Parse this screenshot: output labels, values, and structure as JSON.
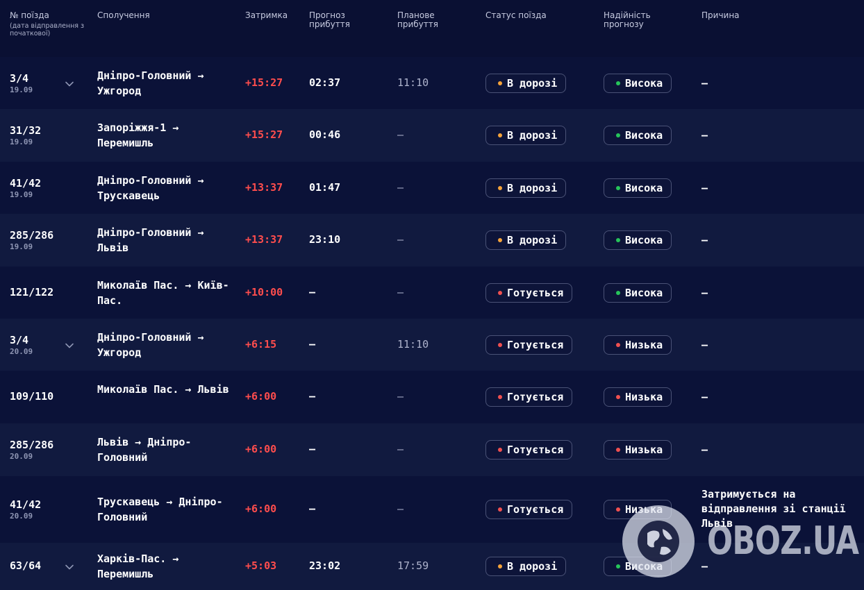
{
  "header": {
    "train_no": "№ поїзда",
    "train_no_sub": "(дата відправлення з початкової)",
    "route": "Сполучення",
    "delay": "Затримка",
    "forecast": "Прогноз прибуття",
    "planned": "Планове прибуття",
    "status": "Статус поїзда",
    "reliability": "Надійність прогнозу",
    "reason": "Причина"
  },
  "colors": {
    "delay": "#ff4d4d",
    "status_en_route_dot": "#f5a33a",
    "status_preparing_dot": "#f05050",
    "reliability_high_dot": "#26c45a",
    "reliability_low_dot": "#f05050"
  },
  "rows": [
    {
      "number": "3/4",
      "date": "19.09",
      "expandable": true,
      "from": "Дніпро-Головний",
      "to": "Ужгород",
      "delay": "+15:27",
      "forecast": "02:37",
      "planned": "11:10",
      "status": "В дорозі",
      "status_color": "#f5a33a",
      "reliability": "Висока",
      "reliability_color": "#26c45a",
      "reason": "—"
    },
    {
      "number": "31/32",
      "date": "19.09",
      "expandable": false,
      "from": "Запоріжжя-1",
      "to": "Перемишль",
      "delay": "+15:27",
      "forecast": "00:46",
      "planned": "—",
      "status": "В дорозі",
      "status_color": "#f5a33a",
      "reliability": "Висока",
      "reliability_color": "#26c45a",
      "reason": "—"
    },
    {
      "number": "41/42",
      "date": "19.09",
      "expandable": false,
      "from": "Дніпро-Головний",
      "to": "Трускавець",
      "delay": "+13:37",
      "forecast": "01:47",
      "planned": "—",
      "status": "В дорозі",
      "status_color": "#f5a33a",
      "reliability": "Висока",
      "reliability_color": "#26c45a",
      "reason": "—"
    },
    {
      "number": "285/286",
      "date": "19.09",
      "expandable": false,
      "from": "Дніпро-Головний",
      "to": "Львів",
      "delay": "+13:37",
      "forecast": "23:10",
      "planned": "—",
      "status": "В дорозі",
      "status_color": "#f5a33a",
      "reliability": "Висока",
      "reliability_color": "#26c45a",
      "reason": "—"
    },
    {
      "number": "121/122",
      "date": "",
      "expandable": false,
      "from": "Миколаїв Пас.",
      "to": "Київ-Пас.",
      "delay": "+10:00",
      "forecast": "—",
      "planned": "—",
      "status": "Готується",
      "status_color": "#f05050",
      "reliability": "Висока",
      "reliability_color": "#26c45a",
      "reason": "—"
    },
    {
      "number": "3/4",
      "date": "20.09",
      "expandable": true,
      "from": "Дніпро-Головний",
      "to": "Ужгород",
      "delay": "+6:15",
      "forecast": "—",
      "planned": "11:10",
      "status": "Готується",
      "status_color": "#f05050",
      "reliability": "Низька",
      "reliability_color": "#f05050",
      "reason": "—"
    },
    {
      "number": "109/110",
      "date": "",
      "expandable": false,
      "from": "Миколаїв Пас.",
      "to": "Львів",
      "delay": "+6:00",
      "forecast": "—",
      "planned": "—",
      "status": "Готується",
      "status_color": "#f05050",
      "reliability": "Низька",
      "reliability_color": "#f05050",
      "reason": "—"
    },
    {
      "number": "285/286",
      "date": "20.09",
      "expandable": false,
      "from": "Львів",
      "to": "Дніпро-Головний",
      "delay": "+6:00",
      "forecast": "—",
      "planned": "—",
      "status": "Готується",
      "status_color": "#f05050",
      "reliability": "Низька",
      "reliability_color": "#f05050",
      "reason": "—"
    },
    {
      "number": "41/42",
      "date": "20.09",
      "expandable": false,
      "from": "Трускавець",
      "to": "Дніпро-Головний",
      "delay": "+6:00",
      "forecast": "—",
      "planned": "—",
      "status": "Готується",
      "status_color": "#f05050",
      "reliability": "Низька",
      "reliability_color": "#f05050",
      "reason": "Затримується на відправлення зі станції Львів"
    },
    {
      "number": "63/64",
      "date": "",
      "expandable": true,
      "from": "Харків-Пас.",
      "to": "Перемишль",
      "delay": "+5:03",
      "forecast": "23:02",
      "planned": "17:59",
      "status": "В дорозі",
      "status_color": "#f5a33a",
      "reliability": "Висока",
      "reliability_color": "#26c45a",
      "reason": "—"
    }
  ],
  "watermark": {
    "text": "OBOZ.UA",
    "icon": "globe-icon"
  }
}
